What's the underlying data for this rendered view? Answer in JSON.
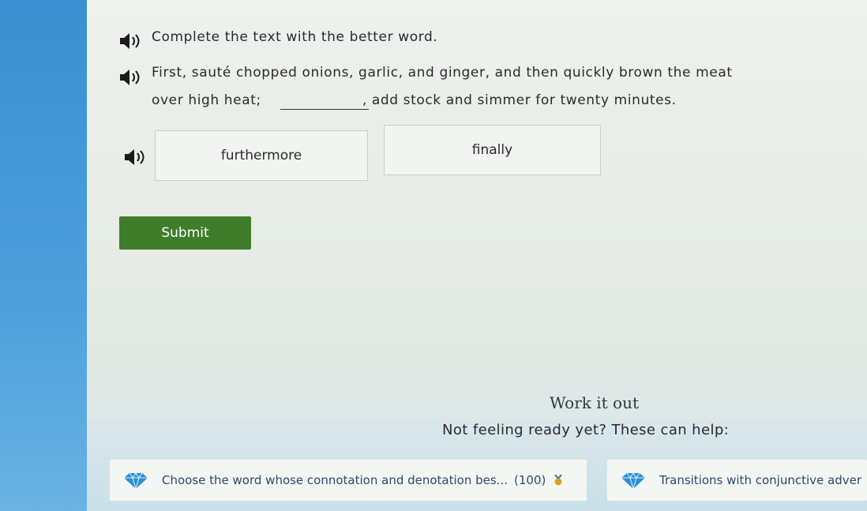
{
  "question": {
    "instruction": "Complete the text with the better word.",
    "passage_line1": "First, sauté chopped onions, garlic, and ginger, and then quickly brown the meat",
    "passage_line2_start": "over high heat;",
    "passage_line2_end": ", add stock and simmer for twenty minutes."
  },
  "choices": [
    {
      "label": "furthermore"
    },
    {
      "label": "finally"
    }
  ],
  "submit_label": "Submit",
  "help": {
    "title": "Work it out",
    "subtitle": "Not feeling ready yet? These can help:",
    "cards": [
      {
        "label": "Choose the word whose connotation and denotation bes...",
        "score": "(100)"
      },
      {
        "label": "Transitions with conjunctive adver"
      }
    ]
  },
  "colors": {
    "submit_bg": "#3f7d2a",
    "side_blue": "#3a8fd0",
    "gem_blue": "#2b8fd6",
    "medal_gold": "#d9a21c"
  },
  "icons": [
    "speaker-icon",
    "gem-icon",
    "medal-icon"
  ]
}
